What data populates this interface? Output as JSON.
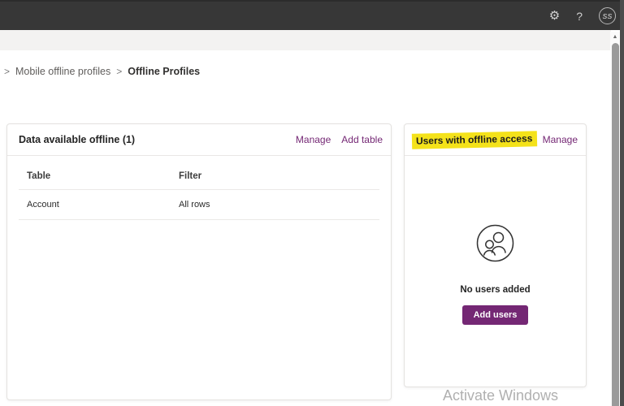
{
  "topbar": {
    "settings_icon": "⚙",
    "help_icon": "?",
    "avatar_initials": "SS"
  },
  "breadcrumb": {
    "separator": ">",
    "items": [
      "Mobile offline profiles",
      "Offline Profiles"
    ]
  },
  "offline_data_card": {
    "title": "Data available offline (1)",
    "manage_label": "Manage",
    "add_table_label": "Add table",
    "table": {
      "columns": [
        "Table",
        "Filter"
      ],
      "rows": [
        [
          "Account",
          "All rows"
        ]
      ]
    }
  },
  "users_card": {
    "title": "Users with offline access",
    "manage_label": "Manage",
    "empty_message": "No users added",
    "add_users_label": "Add users"
  },
  "watermark": "Activate Windows",
  "scrollbar": {
    "up_icon": "▲"
  },
  "colors": {
    "accent_purple": "#742774",
    "highlight_yellow": "#f4e21a",
    "topbar_bg": "#373737"
  }
}
